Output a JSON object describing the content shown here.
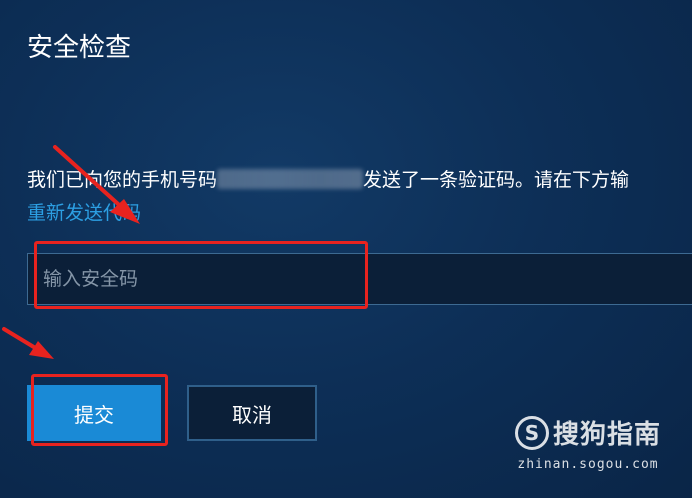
{
  "dialog": {
    "title": "安全检查",
    "message_before": "我们已向您的手机号码",
    "message_after": "发送了一条验证码。请在下方输",
    "resend_link": "重新发送代码",
    "input_placeholder": "输入安全码",
    "submit_label": "提交",
    "cancel_label": "取消"
  },
  "watermark": {
    "logo_glyph": "S",
    "name": "搜狗指南",
    "url": "zhinan.sogou.com"
  },
  "colors": {
    "background": "#0d2f57",
    "link": "#2c9fe3",
    "primary_button": "#1a8ad6",
    "annotation": "#e8231f"
  },
  "icons": {
    "logo": "sogou-logo-icon",
    "arrows": "annotation-arrow-icon"
  }
}
